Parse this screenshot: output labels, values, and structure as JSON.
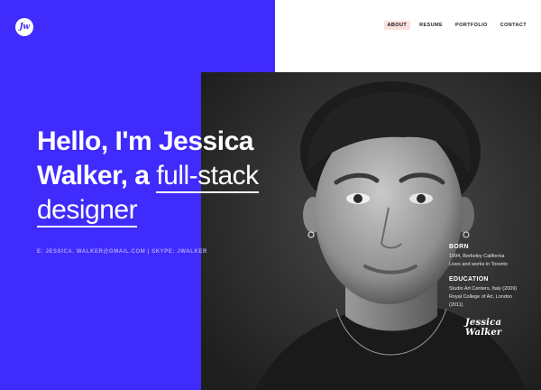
{
  "logo": {
    "text": "Jw"
  },
  "nav": {
    "items": [
      {
        "label": "ABOUT",
        "active": true
      },
      {
        "label": "RESUME",
        "active": false
      },
      {
        "label": "PORTFOLIO",
        "active": false
      },
      {
        "label": "CONTACT",
        "active": false
      }
    ]
  },
  "hero": {
    "headline_part1": "Hello, I'm Jessica Walker, a ",
    "headline_part2": "full-stack designer",
    "contact": "E: JESSICA. WALKER@GMAIL.COM | SKYPE: JWALKER"
  },
  "bio": {
    "born_heading": "BORN",
    "born_line1": "1994, Berkeley California",
    "born_line2": "Lives and works in Toronto",
    "education_heading": "EDUCATION",
    "education_line1": "Studio Art Centers, Italy (2009)",
    "education_line2": "Royal College of Art, London",
    "education_line3": "(2011)"
  },
  "signature": "Jessica Walker",
  "colors": {
    "accent": "#3f2bfb",
    "active_nav_bg": "#fde1e1",
    "photo_bg": "#2c2c2c"
  }
}
